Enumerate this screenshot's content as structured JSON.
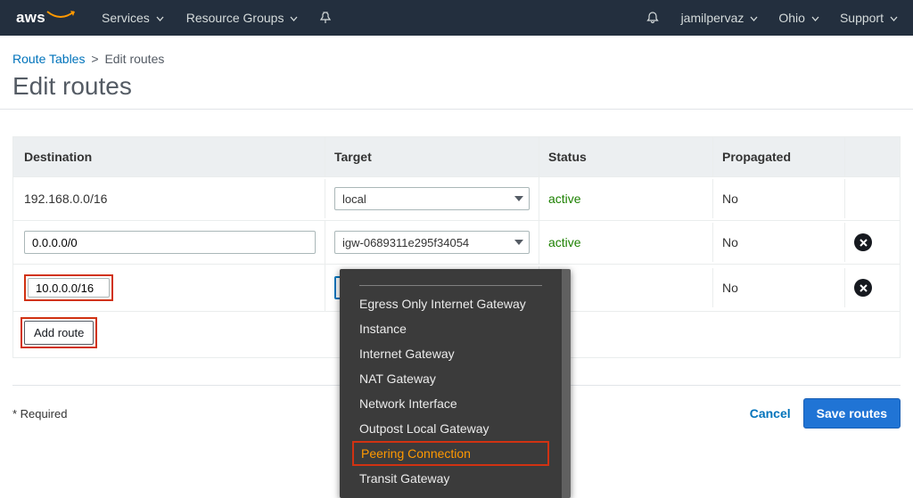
{
  "nav": {
    "logo_text": "aws",
    "services": "Services",
    "resource_groups": "Resource Groups",
    "user": "jamilpervaz",
    "region": "Ohio",
    "support": "Support"
  },
  "crumbs": {
    "route_tables": "Route Tables",
    "sep": ">",
    "current": "Edit routes"
  },
  "page_title": "Edit routes",
  "table": {
    "headers": {
      "destination": "Destination",
      "target": "Target",
      "status": "Status",
      "propagated": "Propagated"
    },
    "rows": [
      {
        "destination": "192.168.0.0/16",
        "destination_editable": false,
        "target": "local",
        "status": "active",
        "propagated": "No",
        "removable": false
      },
      {
        "destination": "0.0.0.0/0",
        "destination_editable": true,
        "target": "igw-0689311e295f34054",
        "status": "active",
        "propagated": "No",
        "removable": true
      },
      {
        "destination": "10.0.0.0/16",
        "destination_editable": true,
        "highlight": true,
        "target": "",
        "target_open": true,
        "status": "",
        "propagated": "No",
        "removable": true
      }
    ],
    "add_route": "Add route"
  },
  "target_menu": [
    "Egress Only Internet Gateway",
    "Instance",
    "Internet Gateway",
    "NAT Gateway",
    "Network Interface",
    "Outpost Local Gateway",
    "Peering Connection",
    "Transit Gateway"
  ],
  "target_menu_selected_index": 6,
  "footer": {
    "required": "* Required",
    "cancel": "Cancel",
    "save": "Save routes"
  }
}
